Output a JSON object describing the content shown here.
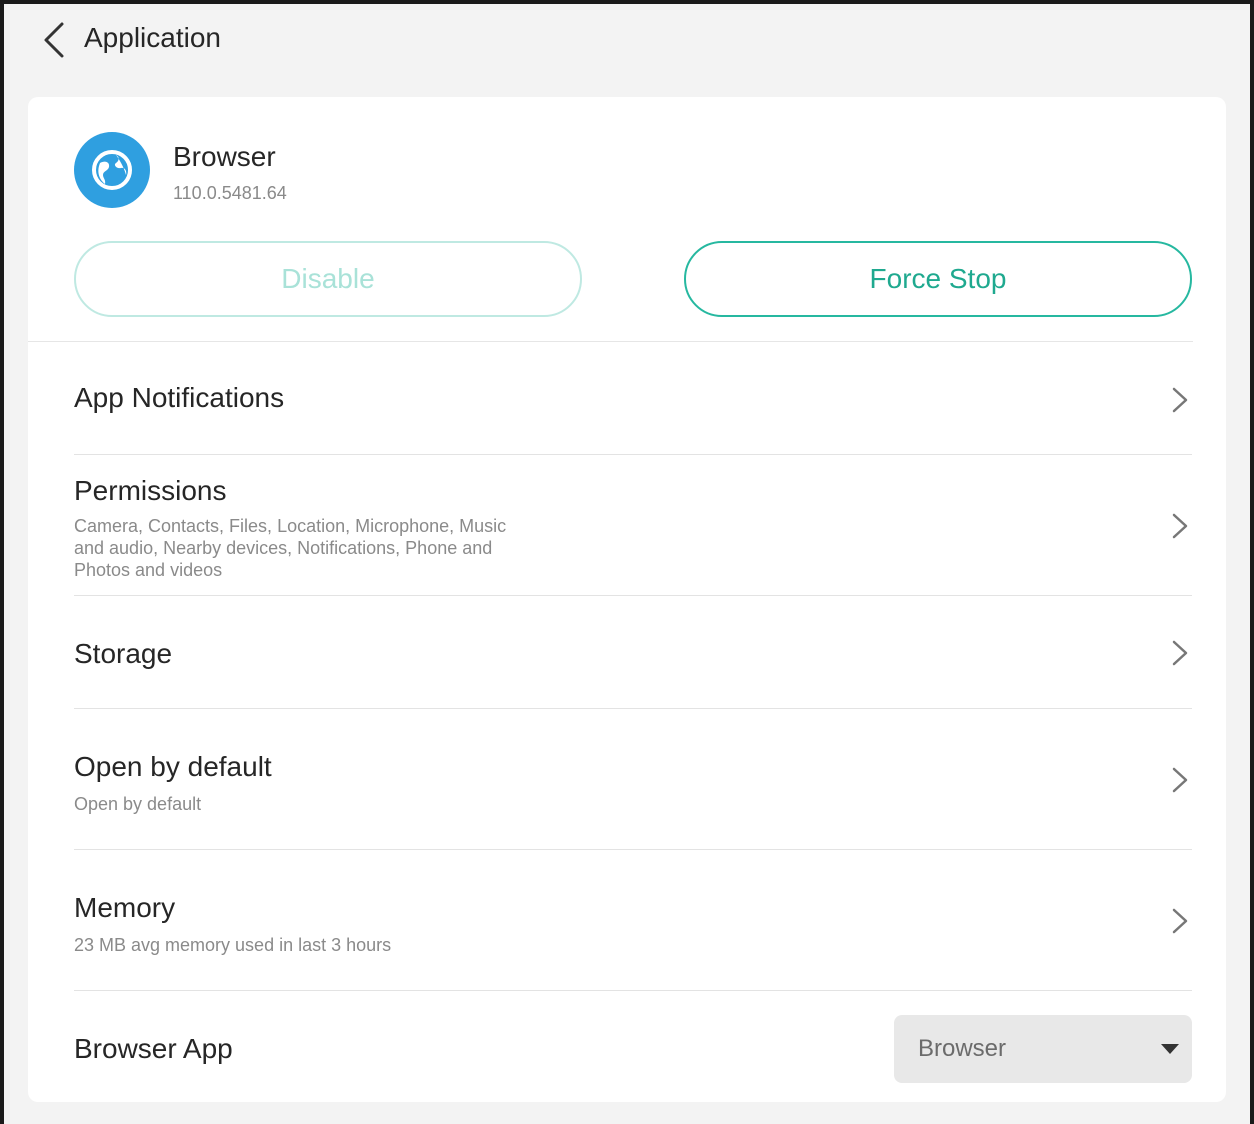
{
  "header": {
    "title": "Application"
  },
  "app": {
    "name": "Browser",
    "version": "110.0.5481.64"
  },
  "actions": {
    "disable_label": "Disable",
    "force_stop_label": "Force Stop",
    "accent_color": "#1fa98f"
  },
  "settings": {
    "notifications": {
      "title": "App Notifications"
    },
    "permissions": {
      "title": "Permissions",
      "line1": "Camera, Contacts, Files, Location, Microphone, Music",
      "line2": "and audio, Nearby devices, Notifications, Phone and",
      "line3": "Photos and videos"
    },
    "storage": {
      "title": "Storage"
    },
    "open_by_default": {
      "title": "Open by default",
      "subtitle": "Open by default"
    },
    "memory": {
      "title": "Memory",
      "subtitle": "23 MB avg memory used in last 3 hours"
    },
    "browser_app": {
      "title": "Browser App",
      "selected": "Browser"
    }
  }
}
